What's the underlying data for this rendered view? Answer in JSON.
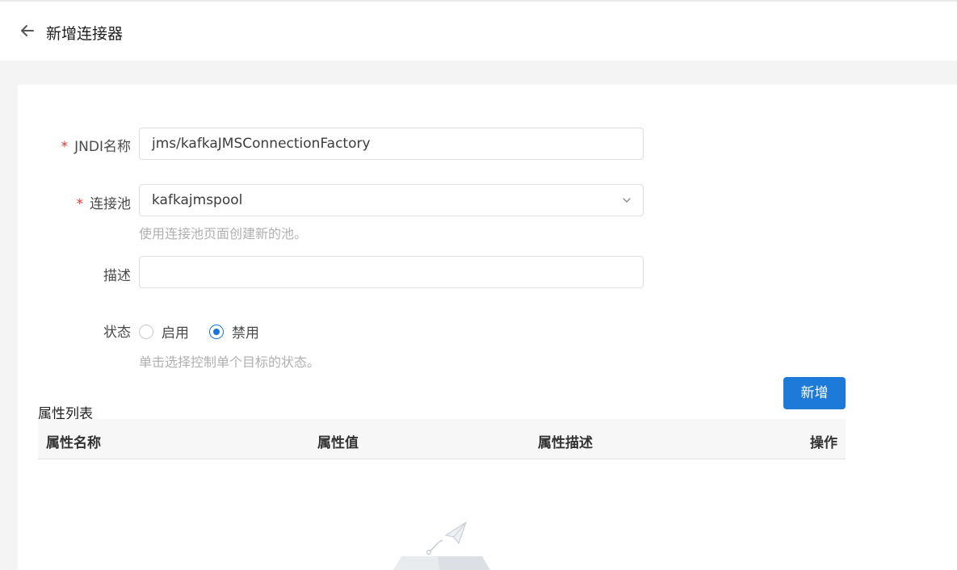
{
  "header": {
    "title": "新增连接器",
    "back_icon": "arrow-left-icon"
  },
  "form": {
    "jndi": {
      "label": "JNDI名称",
      "required_mark": "*",
      "value": "jms/kafkaJMSConnectionFactory"
    },
    "pool": {
      "label": "连接池",
      "required_mark": "*",
      "value": "kafkajmspool",
      "hint": "使用连接池页面创建新的池。"
    },
    "description": {
      "label": "描述",
      "value": ""
    },
    "status": {
      "label": "状态",
      "options": [
        "启用",
        "禁用"
      ],
      "selected": "禁用",
      "hint": "单击选择控制单个目标的状态。"
    }
  },
  "properties": {
    "add_label": "新增",
    "title": "属性列表",
    "columns": [
      "属性名称",
      "属性值",
      "属性描述",
      "操作"
    ],
    "rows": []
  },
  "colors": {
    "primary": "#1e7ad8",
    "required": "#e53935"
  }
}
